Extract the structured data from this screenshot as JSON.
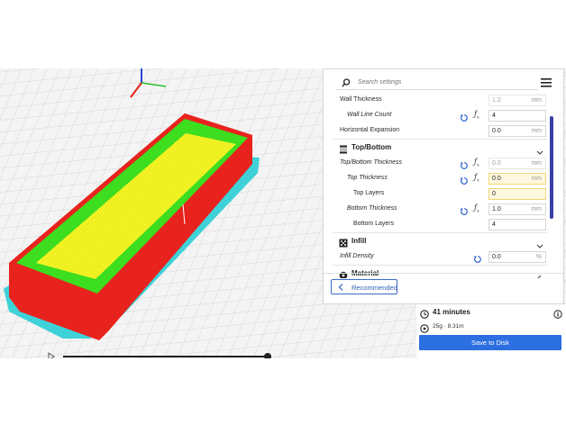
{
  "search": {
    "placeholder": "Search settings"
  },
  "settings": {
    "wall_thickness": {
      "label": "Wall Thickness",
      "value": "1.2",
      "unit": "mm"
    },
    "wall_line_count": {
      "label": "Wall Line Count",
      "value": "4"
    },
    "horizontal_expansion": {
      "label": "Horizontal Expansion",
      "value": "0.0",
      "unit": "mm"
    },
    "top_bottom": {
      "label": "Top/Bottom"
    },
    "top_bottom_thickness": {
      "label": "Top/Bottom Thickness",
      "value": "0.0",
      "unit": "mm"
    },
    "top_thickness": {
      "label": "Top Thickness",
      "value": "0.0",
      "unit": "mm"
    },
    "top_layers": {
      "label": "Top Layers",
      "value": "0"
    },
    "bottom_thickness": {
      "label": "Bottom Thickness",
      "value": "1.0",
      "unit": "mm"
    },
    "bottom_layers": {
      "label": "Bottom Layers",
      "value": "4"
    },
    "infill": {
      "label": "Infill"
    },
    "infill_density": {
      "label": "Infill Density",
      "value": "0.0",
      "unit": "%"
    },
    "material": {
      "label": "Material"
    }
  },
  "buttons": {
    "recommended": "Recommended",
    "save_to_disk": "Save to Disk"
  },
  "print_info": {
    "time": "41 minutes",
    "material": "25g · 8.31m"
  },
  "colors": {
    "walls": "#e8231e",
    "top_skin": "#f2f22e",
    "inner_wall": "#3ddd1f",
    "skirt": "#39d3d9",
    "accent": "#2b6fe0",
    "scrollbar": "#3a3fa6"
  }
}
